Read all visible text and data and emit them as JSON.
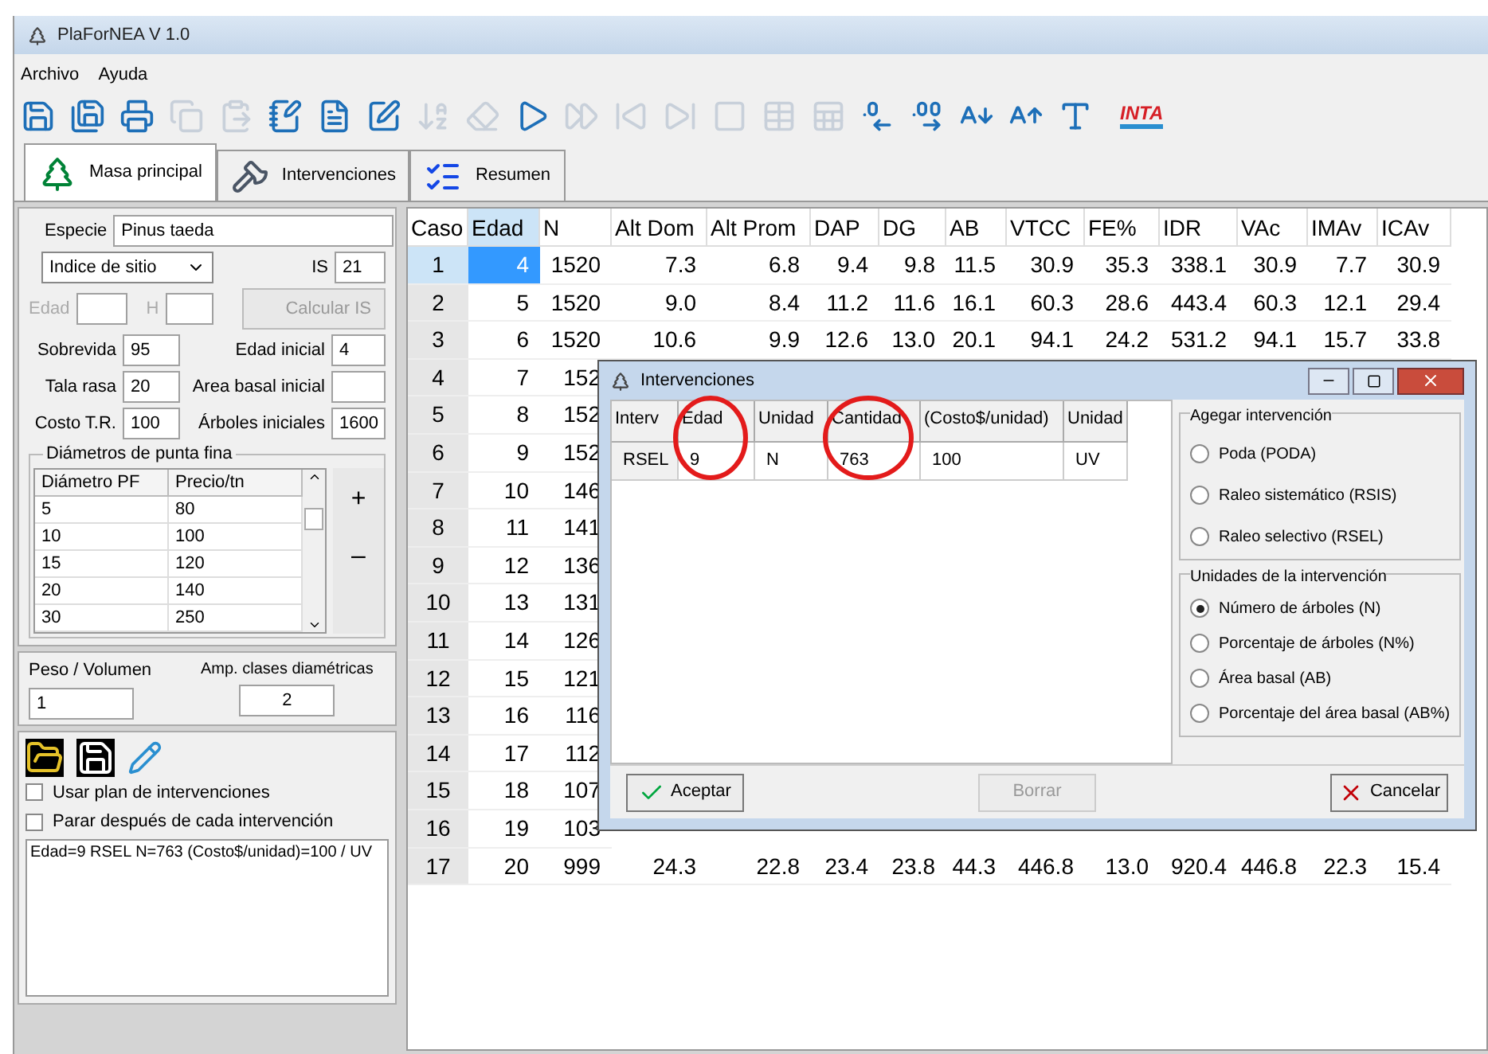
{
  "window": {
    "title": "PlaForNEA V 1.0"
  },
  "menu": [
    "Archivo",
    "Ayuda"
  ],
  "toolbar": [
    {
      "kind": "save",
      "disabled": false
    },
    {
      "kind": "saveas",
      "disabled": false
    },
    {
      "kind": "print",
      "disabled": false
    },
    {
      "kind": "copy",
      "disabled": true
    },
    {
      "kind": "paste",
      "disabled": true
    },
    {
      "kind": "notepad",
      "disabled": false
    },
    {
      "kind": "document",
      "disabled": false
    },
    {
      "kind": "edit",
      "disabled": false
    },
    {
      "kind": "sort",
      "disabled": true
    },
    {
      "kind": "eraser",
      "disabled": true
    },
    {
      "kind": "play",
      "disabled": false
    },
    {
      "kind": "forward",
      "disabled": true
    },
    {
      "kind": "first",
      "disabled": true
    },
    {
      "kind": "last",
      "disabled": true
    },
    {
      "kind": "stop",
      "disabled": true
    },
    {
      "kind": "table",
      "disabled": true
    },
    {
      "kind": "sheet",
      "disabled": true
    },
    {
      "kind": "decless",
      "disabled": false
    },
    {
      "kind": "decmore",
      "disabled": false
    },
    {
      "kind": "fontdown",
      "disabled": false
    },
    {
      "kind": "fontup",
      "disabled": false
    },
    {
      "kind": "font",
      "disabled": false
    }
  ],
  "logo": "INTA",
  "tabs": [
    {
      "label": "Masa principal",
      "kind": "tree",
      "selected": true
    },
    {
      "label": "Intervenciones",
      "kind": "saw",
      "selected": false
    },
    {
      "label": "Resumen",
      "kind": "checklist",
      "selected": false
    }
  ],
  "form": {
    "especie_label": "Especie",
    "especie": "Pinus taeda",
    "index_select": "Indice de sitio",
    "is_label": "IS",
    "is": "21",
    "edad_label": "Edad",
    "h_label": "H",
    "calc_button": "Calcular IS",
    "calc_disabled": true,
    "left_fields": [
      {
        "label": "Sobrevida",
        "value": "95"
      },
      {
        "label": "Tala rasa",
        "value": "20"
      },
      {
        "label": "Costo T.R.",
        "value": "100"
      }
    ],
    "right_fields": [
      {
        "label": "Edad inicial",
        "value": "4"
      },
      {
        "label": "Area basal inicial"
      },
      {
        "label": "Árboles iniciales",
        "value": "1600"
      }
    ],
    "diam_group": "Diámetros de punta fina",
    "diam_columns": [
      "Diámetro PF",
      "Precio/tn"
    ],
    "diam_rows": [
      [
        "5",
        "80"
      ],
      [
        "10",
        "100"
      ],
      [
        "15",
        "120"
      ],
      [
        "20",
        "140"
      ],
      [
        "30",
        "250"
      ]
    ],
    "add": "+",
    "remove": "–",
    "peso_label": "Peso / Volumen",
    "peso": "1",
    "amp_label": "Amp. clases diamétricas",
    "amp": "2",
    "checks": [
      {
        "label": "Usar plan de intervenciones",
        "checked": false
      },
      {
        "label": "Parar después de cada intervención",
        "checked": false
      }
    ],
    "log": "Edad=9 RSEL N=763 (Costo$/unidad)=100 / UV"
  },
  "table": {
    "columns": [
      "Caso",
      "Edad",
      "N",
      "Alt Dom",
      "Alt Prom",
      "DAP",
      "DG",
      "AB",
      "VTCC",
      "FE%",
      "IDR",
      "VAc",
      "IMAv",
      "ICAv"
    ],
    "rows": [
      {
        "selected": true,
        "cells": [
          "1",
          "4",
          "1520",
          "7.3",
          "6.8",
          "9.4",
          "9.8",
          "11.5",
          "30.9",
          "35.3",
          "338.1",
          "30.9",
          "7.7",
          "30.9"
        ]
      },
      {
        "selected": false,
        "cells": [
          "2",
          "5",
          "1520",
          "9.0",
          "8.4",
          "11.2",
          "11.6",
          "16.1",
          "60.3",
          "28.6",
          "443.4",
          "60.3",
          "12.1",
          "29.4"
        ]
      },
      {
        "selected": false,
        "cells": [
          "3",
          "6",
          "1520",
          "10.6",
          "9.9",
          "12.6",
          "13.0",
          "20.1",
          "94.1",
          "24.2",
          "531.2",
          "94.1",
          "15.7",
          "33.8"
        ]
      },
      {
        "selected": false,
        "cells": [
          "4",
          "7",
          "152"
        ]
      },
      {
        "selected": false,
        "cells": [
          "5",
          "8",
          "152"
        ]
      },
      {
        "selected": false,
        "cells": [
          "6",
          "9",
          "152"
        ]
      },
      {
        "selected": false,
        "cells": [
          "7",
          "10",
          "146"
        ]
      },
      {
        "selected": false,
        "cells": [
          "8",
          "11",
          "141"
        ]
      },
      {
        "selected": false,
        "cells": [
          "9",
          "12",
          "136"
        ]
      },
      {
        "selected": false,
        "cells": [
          "10",
          "13",
          "131"
        ]
      },
      {
        "selected": false,
        "cells": [
          "11",
          "14",
          "126"
        ]
      },
      {
        "selected": false,
        "cells": [
          "12",
          "15",
          "121"
        ]
      },
      {
        "selected": false,
        "cells": [
          "13",
          "16",
          "116"
        ]
      },
      {
        "selected": false,
        "cells": [
          "14",
          "17",
          "112"
        ]
      },
      {
        "selected": false,
        "cells": [
          "15",
          "18",
          "107"
        ]
      },
      {
        "selected": false,
        "cells": [
          "16",
          "19",
          "103"
        ]
      },
      {
        "selected": false,
        "cells": [
          "17",
          "20",
          "999",
          "24.3",
          "22.8",
          "23.4",
          "23.8",
          "44.3",
          "446.8",
          "13.0",
          "920.4",
          "446.8",
          "22.3",
          "15.4"
        ]
      }
    ]
  },
  "dialog": {
    "title": "Intervenciones",
    "columns": [
      {
        "label": "Interv",
        "circled": false
      },
      {
        "label": "Edad",
        "circled": true
      },
      {
        "label": "Unidad",
        "circled": false
      },
      {
        "label": "Cantidad",
        "circled": true
      },
      {
        "label": "(Costo$/unidad)",
        "circled": false
      },
      {
        "label": "Unidad",
        "circled": false
      }
    ],
    "rows": [
      [
        "RSEL",
        "9",
        "N",
        "763",
        "100",
        "UV"
      ]
    ],
    "add_group": "Agegar intervención",
    "add_options": [
      {
        "label": "Poda (PODA)",
        "selected": false
      },
      {
        "label": "Raleo sistemático (RSIS)",
        "selected": false
      },
      {
        "label": "Raleo selectivo (RSEL)",
        "selected": false
      }
    ],
    "units_group": "Unidades de la intervención",
    "unit_options": [
      {
        "label": "Número de árboles (N)",
        "selected": true
      },
      {
        "label": "Porcentaje de árboles (N%)",
        "selected": false
      },
      {
        "label": "Área basal (AB)",
        "selected": false
      },
      {
        "label": "Porcentaje del área basal (AB%)",
        "selected": false
      }
    ],
    "buttons": [
      {
        "label": "Aceptar",
        "kind": "accept",
        "disabled": false
      },
      {
        "label": "Borrar",
        "kind": "delete",
        "disabled": true
      },
      {
        "label": "Cancelar",
        "kind": "cancel",
        "disabled": false
      }
    ]
  }
}
